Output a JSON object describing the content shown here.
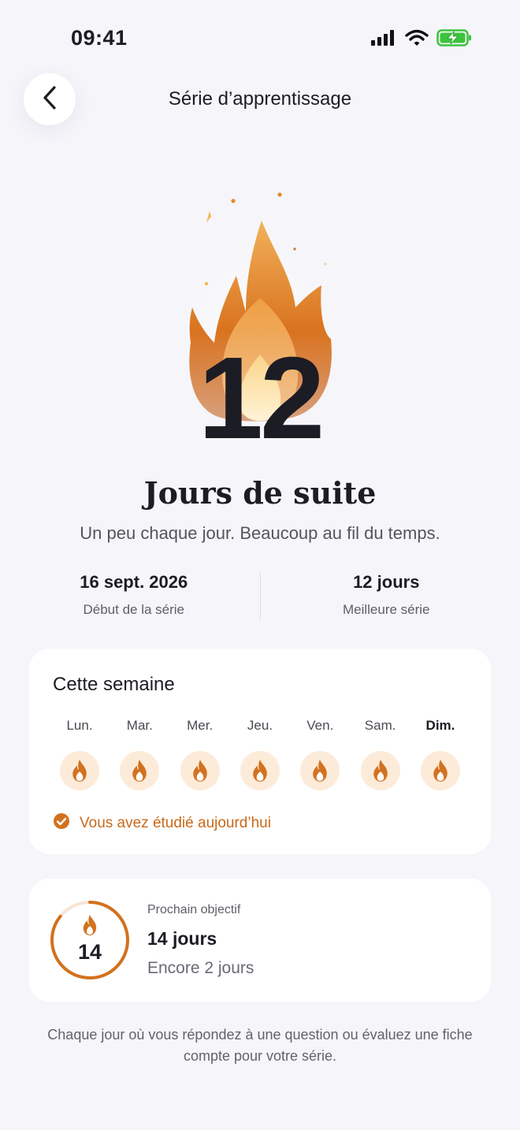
{
  "status_bar": {
    "time": "09:41",
    "icons": [
      "signal-icon",
      "wifi-icon",
      "battery-charging-icon"
    ]
  },
  "nav": {
    "back_icon": "chevron-left-icon",
    "title": "Série d’apprentissage"
  },
  "hero": {
    "streak_count": "12",
    "title": "Jours de suite",
    "subtitle": "Un peu chaque jour. Beaucoup au fil du temps."
  },
  "stats": [
    {
      "value": "16 sept. 2026",
      "label": "Début de la série"
    },
    {
      "value": "12 jours",
      "label": "Meilleure série"
    }
  ],
  "week": {
    "title": "Cette semaine",
    "days": [
      {
        "label": "Lun.",
        "done": true,
        "today": false
      },
      {
        "label": "Mar.",
        "done": true,
        "today": false
      },
      {
        "label": "Mer.",
        "done": true,
        "today": false
      },
      {
        "label": "Jeu.",
        "done": true,
        "today": false
      },
      {
        "label": "Ven.",
        "done": true,
        "today": false
      },
      {
        "label": "Sam.",
        "done": true,
        "today": false
      },
      {
        "label": "Dim.",
        "done": true,
        "today": true
      }
    ],
    "studied_text": "Vous avez étudié aujourd’hui"
  },
  "goal": {
    "label": "Prochain objectif",
    "value": "14 jours",
    "ring_number": "14",
    "remaining": "Encore 2 jours",
    "progress": 0.857
  },
  "footnote": "Chaque jour où vous répondez à une question ou évaluez une fiche compte pour votre série.",
  "colors": {
    "accent": "#d2721f",
    "flame_light": "#f7c987",
    "flame_bg": "#fdebd9",
    "background": "#f5f5fa"
  }
}
